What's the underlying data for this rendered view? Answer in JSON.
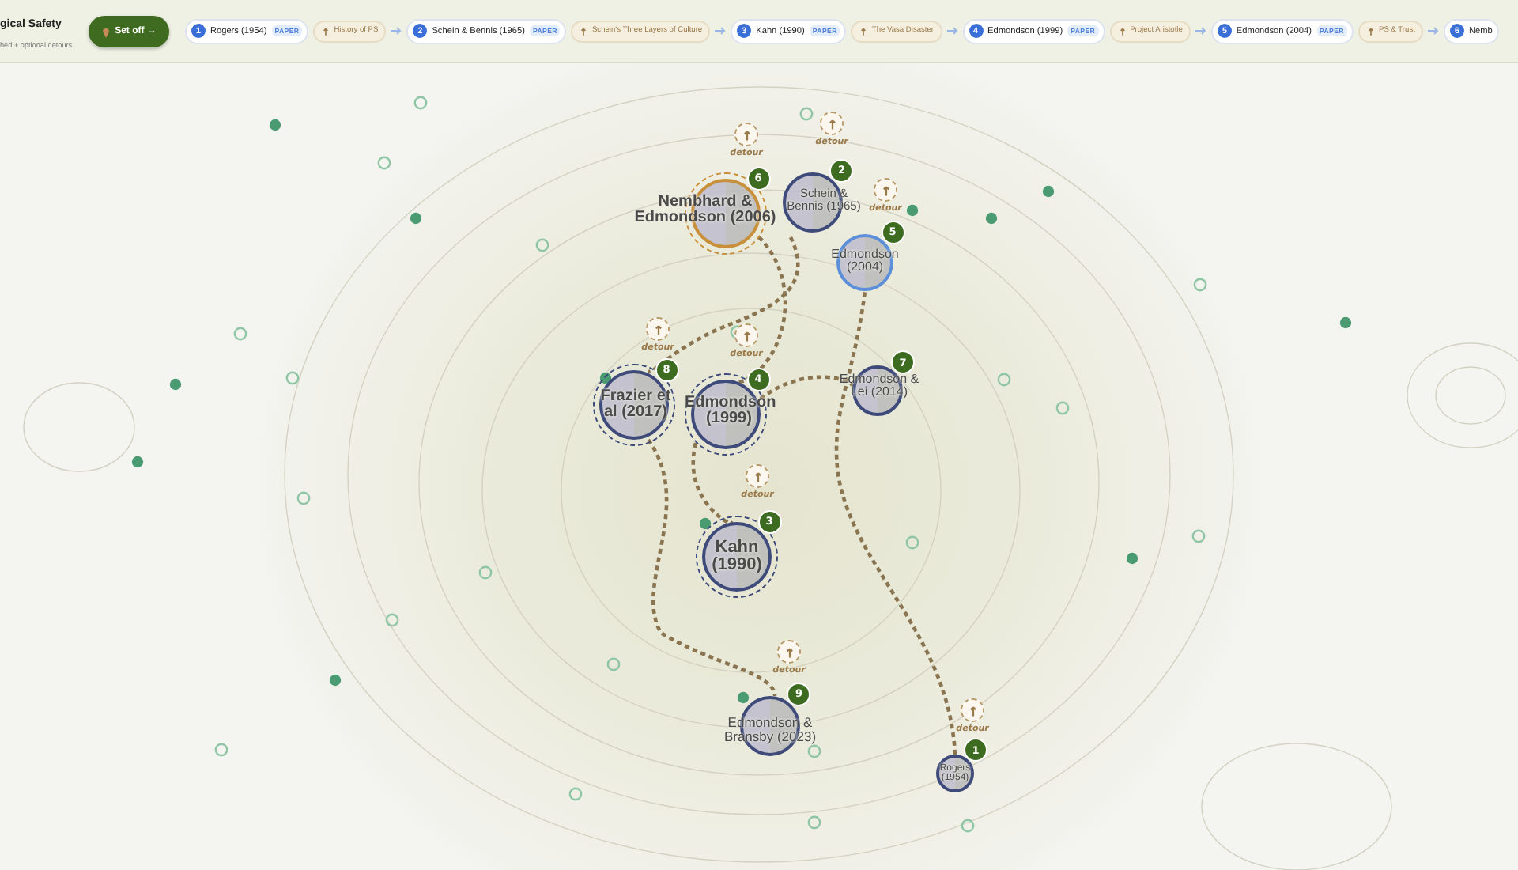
{
  "header": {
    "title": "gical Safety",
    "subtitle": "hed + optional detours",
    "start_button": "Set off →"
  },
  "route": [
    {
      "kind": "step",
      "number": "1",
      "label": "Rogers (1954)",
      "badge": "PAPER"
    },
    {
      "kind": "detour",
      "label": "History of PS"
    },
    {
      "kind": "step",
      "number": "2",
      "label": "Schein & Bennis (1965)",
      "badge": "PAPER"
    },
    {
      "kind": "detour",
      "label": "Schein's Three Layers of Culture"
    },
    {
      "kind": "step",
      "number": "3",
      "label": "Kahn (1990)",
      "badge": "PAPER"
    },
    {
      "kind": "detour",
      "label": "The Vasa Disaster"
    },
    {
      "kind": "step",
      "number": "4",
      "label": "Edmondson (1999)",
      "badge": "PAPER"
    },
    {
      "kind": "detour",
      "label": "Project Aristotle"
    },
    {
      "kind": "step",
      "number": "5",
      "label": "Edmondson (2004)",
      "badge": "PAPER"
    },
    {
      "kind": "detour",
      "label": "PS & Trust"
    },
    {
      "kind": "step",
      "number": "6",
      "label": "Nemb"
    }
  ],
  "map": {
    "nodes": [
      {
        "number": "6",
        "label": "Nembhard & Edmondson (2006)",
        "color": "#c8903a",
        "ringed": true
      },
      {
        "number": "2",
        "label": "Schein & Bennis (1965)",
        "color": "#3d4a7a",
        "ringed": false
      },
      {
        "number": "5",
        "label": "Edmondson (2004)",
        "color": "#5b8fd9",
        "ringed": false
      },
      {
        "number": "8",
        "label": "Frazier et al (2017)",
        "color": "#3d4a7a",
        "ringed": true
      },
      {
        "number": "4",
        "label": "Edmondson (1999)",
        "color": "#3d4a7a",
        "ringed": true
      },
      {
        "number": "7",
        "label": "Edmondson & Lei (2014)",
        "color": "#3d4a7a",
        "ringed": false
      },
      {
        "number": "3",
        "label": "Kahn (1990)",
        "color": "#3d4a7a",
        "ringed": true
      },
      {
        "number": "9",
        "label": "Edmondson & Bransby (2023)",
        "color": "#3d4a7a",
        "ringed": false
      },
      {
        "number": "1",
        "label": "Rogers (1954)",
        "color": "#3d4a7a",
        "ringed": false
      }
    ],
    "detours": [
      {
        "label": "detour"
      },
      {
        "label": "detour"
      },
      {
        "label": "detour"
      },
      {
        "label": "detour"
      },
      {
        "label": "detour"
      },
      {
        "label": "detour"
      },
      {
        "label": "detour"
      },
      {
        "label": "detour"
      }
    ]
  }
}
